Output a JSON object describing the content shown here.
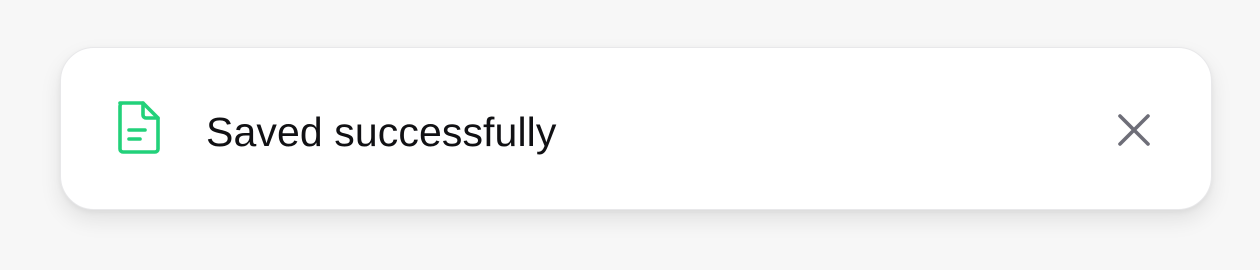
{
  "toast": {
    "message": "Saved successfully",
    "icon": "document-icon",
    "close_icon": "close-icon",
    "accent_color": "#22d17a",
    "close_color": "#6e6e78"
  }
}
